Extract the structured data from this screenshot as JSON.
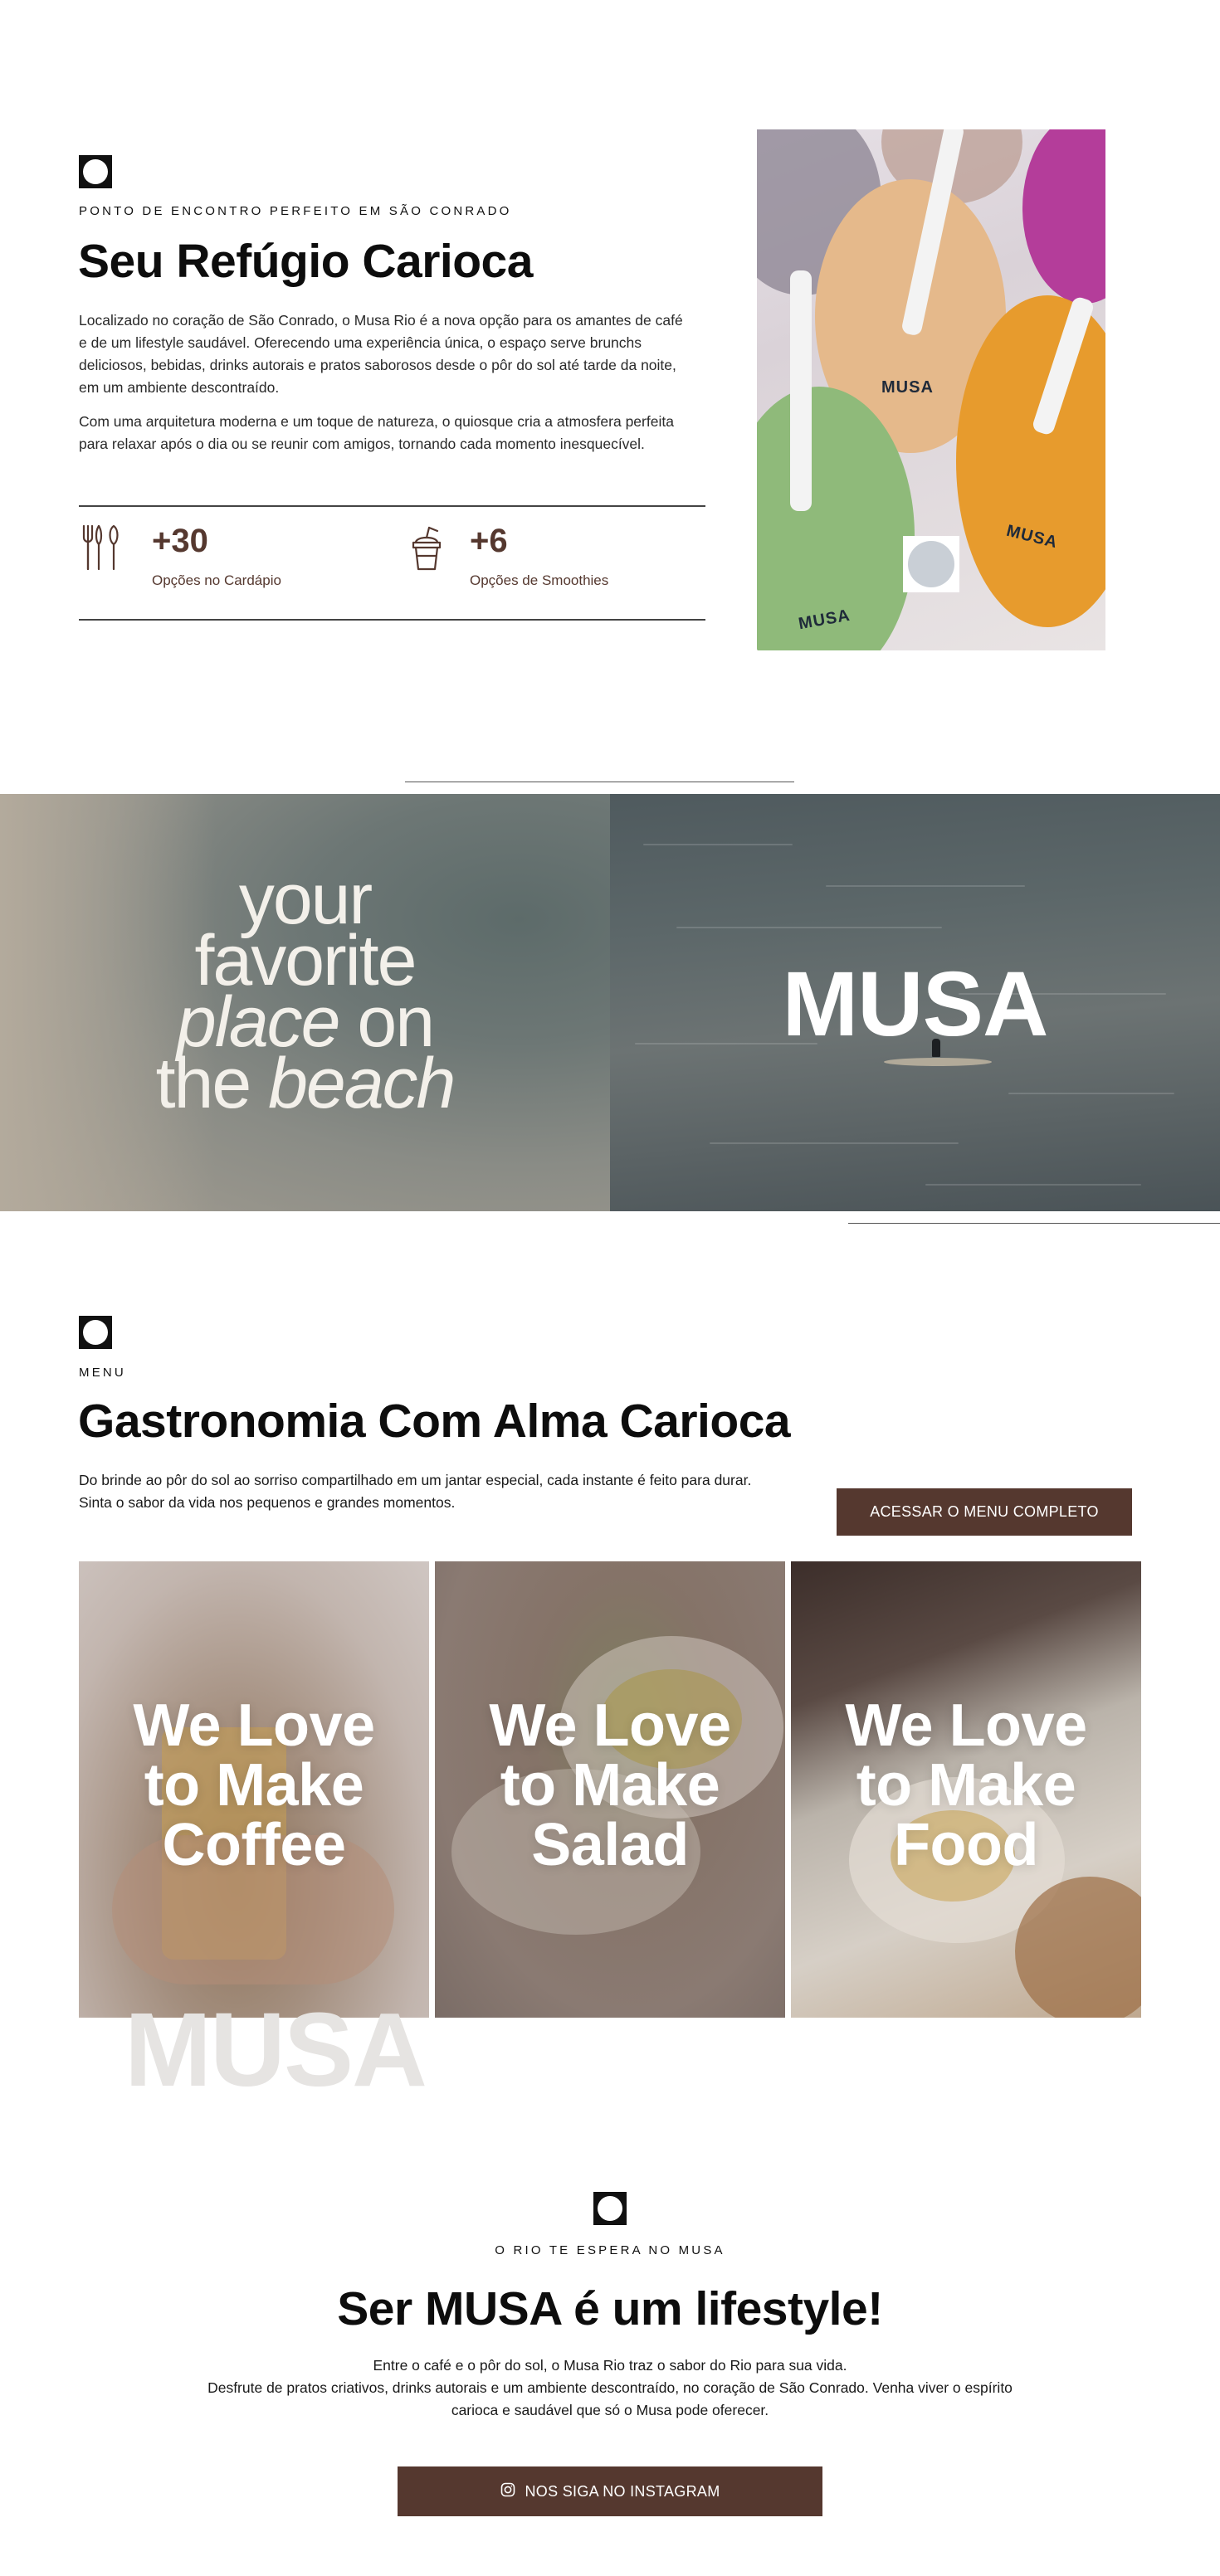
{
  "intro": {
    "eyebrow": "PONTO DE ENCONTRO PERFEITO EM SÃO CONRADO",
    "title": "Seu Refúgio Carioca",
    "paragraph1_line1": "Localizado no coração de São Conrado, o Musa Rio é a nova opção para os amantes de café",
    "paragraph1_line2": "e de um lifestyle saudável. Oferecendo uma experiência única, o espaço serve brunchs",
    "paragraph1_line3": "deliciosos, bebidas, drinks autorais e pratos saborosos desde o pôr do sol até tarde da noite,",
    "paragraph1_line4": "em um ambiente descontraído.",
    "paragraph2_line1": "Com uma arquitetura moderna e um toque de natureza, o quiosque cria a atmosfera perfeita",
    "paragraph2_line2": "para relaxar após o dia ou se reunir com amigos, tornando cada momento inesquecível.",
    "stats": [
      {
        "icon": "cutlery-icon",
        "value": "+30",
        "label": "Opções no Cardápio"
      },
      {
        "icon": "smoothie-cup-icon",
        "value": "+6",
        "label": "Opções de Smoothies"
      }
    ],
    "cup_label": "MUSA"
  },
  "banner": {
    "line1": "your",
    "line2": "favorite",
    "line3_italic": "place",
    "line3_rest": " on",
    "line4_start": "the ",
    "line4_italic": "beach",
    "brand": "MUSA"
  },
  "menu": {
    "eyebrow": "MENU",
    "title": "Gastronomia Com Alma Carioca",
    "desc_line1": "Do brinde ao pôr do sol ao sorriso compartilhado em um jantar especial, cada instante é feito para durar.",
    "desc_line2": "Sinta o sabor da vida nos pequenos e grandes momentos.",
    "button": "ACESSAR O MENU COMPLETO",
    "cards": [
      {
        "line1": "We Love",
        "line2": "to Make",
        "line3": "Coffee"
      },
      {
        "line1": "We Love",
        "line2": "to Make",
        "line3": "Salad"
      },
      {
        "line1": "We Love",
        "line2": "to Make",
        "line3": "Food"
      }
    ],
    "watermark": "MUSA"
  },
  "lifestyle": {
    "eyebrow": "O RIO TE ESPERA NO MUSA",
    "title": "Ser MUSA é um lifestyle!",
    "line1": "Entre o café e o pôr do sol, o Musa Rio traz o sabor do Rio para sua vida.",
    "line2": "Desfrute de pratos criativos, drinks autorais e um ambiente descontraído, no coração de São Conrado. Venha viver o espírito",
    "line3": "carioca e saudável que só o Musa pode oferecer.",
    "button": "NOS SIGA NO INSTAGRAM",
    "button_icon": "instagram-icon"
  },
  "colors": {
    "brand_brown": "#55382f",
    "text_dark": "#0d0d0d"
  }
}
